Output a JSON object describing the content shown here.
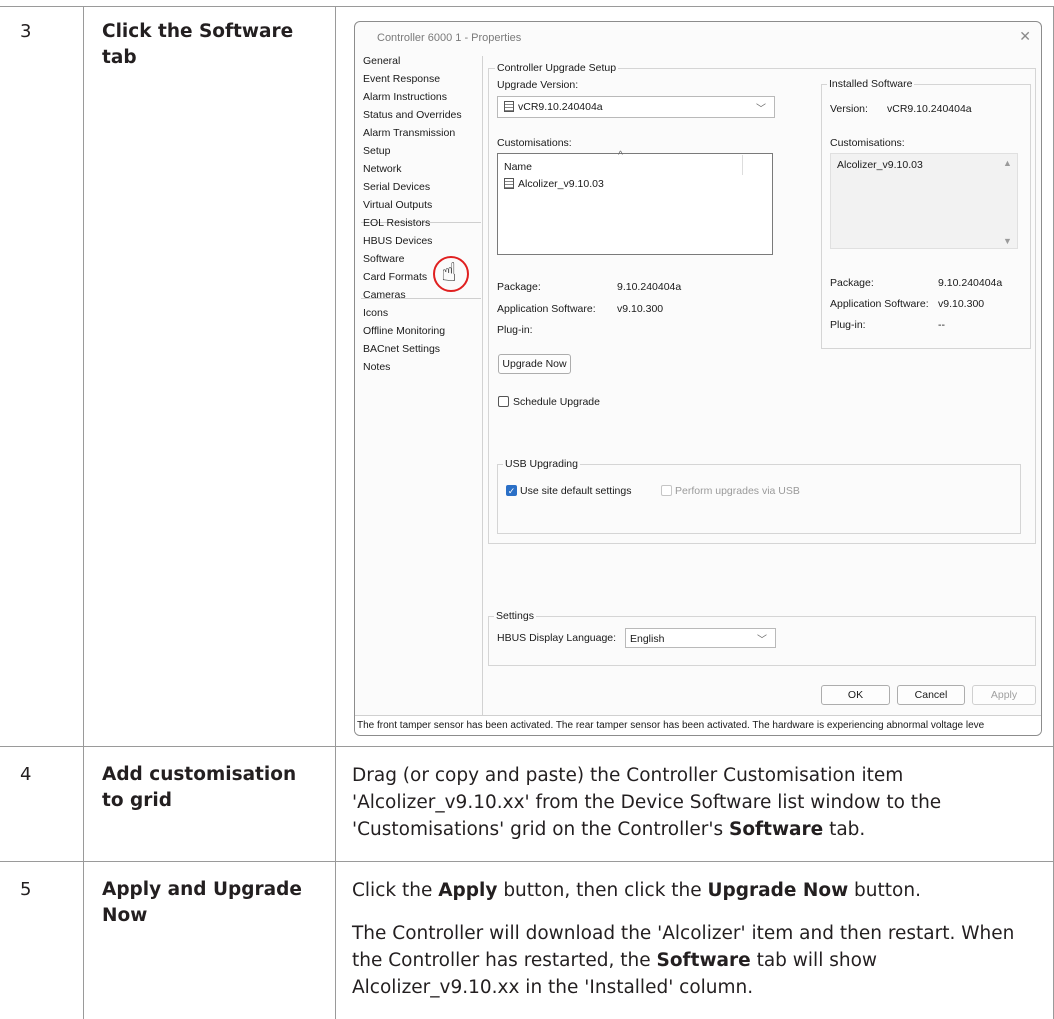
{
  "rows": [
    {
      "num": "3",
      "title": "Click the Software tab"
    },
    {
      "num": "4",
      "title": "Add customisation to grid",
      "body": [
        {
          "t": "Drag (or copy and paste) the Controller Customisation item 'Alcolizer_v9.10.xx' from the Device Software list window to the 'Customisations' grid on the Controller's "
        },
        {
          "t": "Software",
          "b": true
        },
        {
          "t": " tab."
        }
      ]
    },
    {
      "num": "5",
      "title": "Apply and Upgrade Now",
      "p1": [
        {
          "t": "Click the "
        },
        {
          "t": "Apply",
          "b": true
        },
        {
          "t": " button, then click the "
        },
        {
          "t": "Upgrade Now",
          "b": true
        },
        {
          "t": " button."
        }
      ],
      "p2": [
        {
          "t": "The Controller will download the 'Alcolizer' item and then restart. When the Controller has restarted, the "
        },
        {
          "t": "Software",
          "b": true
        },
        {
          "t": " tab will show Alcolizer_v9.10.xx in the 'Installed' column."
        }
      ]
    }
  ],
  "dialog": {
    "title": "Controller 6000 1 - Properties",
    "nav": [
      "General",
      "Event Response",
      "Alarm Instructions",
      "Status and Overrides",
      "Alarm Transmission",
      "Setup",
      "Network",
      "Serial Devices",
      "Virtual Outputs",
      "EOL Resistors",
      "HBUS Devices",
      "Software",
      "Card Formats",
      "Cameras",
      "Icons",
      "Offline Monitoring",
      "BACnet Settings",
      "Notes"
    ],
    "upgrade_group": "Controller Upgrade Setup",
    "upgrade_version_label": "Upgrade Version:",
    "upgrade_version_value": "vCR9.10.240404a",
    "customisations_label": "Customisations:",
    "list_header": "Name",
    "list_item": "Alcolizer_v9.10.03",
    "package_label": "Package:",
    "package_value": "9.10.240404a",
    "app_sw_label": "Application Software:",
    "app_sw_value": "v9.10.300",
    "plugin_label": "Plug-in:",
    "upgrade_now": "Upgrade Now",
    "schedule_upgrade": "Schedule Upgrade",
    "installed": {
      "group": "Installed Software",
      "version_label": "Version:",
      "version_value": "vCR9.10.240404a",
      "customisations_label": "Customisations:",
      "customisation_item": "Alcolizer_v9.10.03",
      "package_label": "Package:",
      "package_value": "9.10.240404a",
      "app_sw_label": "Application Software:",
      "app_sw_value": "v9.10.300",
      "plugin_label": "Plug-in:",
      "plugin_value": "--"
    },
    "usb_group": "USB Upgrading",
    "use_site_default": "Use site default settings",
    "perform_usb": "Perform upgrades via USB",
    "settings_group": "Settings",
    "hbus_lang_label": "HBUS Display Language:",
    "hbus_lang_value": "English",
    "ok": "OK",
    "cancel": "Cancel",
    "apply": "Apply",
    "status": "The front tamper sensor has been activated.  The rear tamper sensor has been activated.  The hardware is experiencing abnormal voltage leve"
  }
}
